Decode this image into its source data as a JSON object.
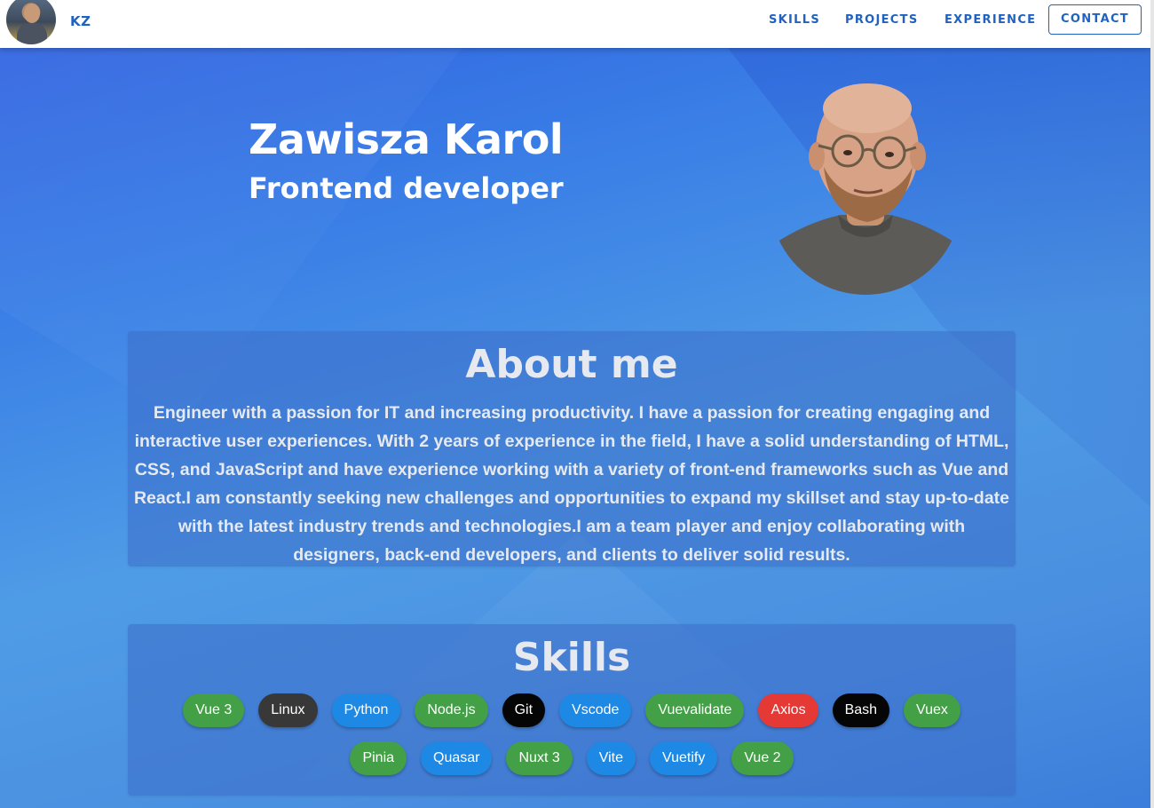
{
  "header": {
    "logo_text": "KZ",
    "nav": {
      "skills": "SKILLS",
      "projects": "PROJECTS",
      "experience": "EXPERIENCE",
      "contact": "CONTACT"
    }
  },
  "hero": {
    "name": "Zawisza Karol",
    "role": "Frontend developer"
  },
  "about": {
    "title": "About me",
    "text": "Engineer with a passion for IT and increasing productivity. I have a passion for creating engaging and interactive user experiences. With 2 years of experience in the field, I have a solid understanding of HTML, CSS, and JavaScript and have experience working with a variety of front-end frameworks such as Vue and React.I am constantly seeking new challenges and opportunities to expand my skillset and stay up-to-date with the latest industry trends and technologies.I am a team player and enjoy collaborating with designers, back-end developers, and clients to deliver solid results."
  },
  "skills": {
    "title": "Skills",
    "rows": [
      [
        {
          "label": "Vue 3",
          "color": "#43a047"
        },
        {
          "label": "Linux",
          "color": "#383838"
        },
        {
          "label": "Python",
          "color": "#1e88e5"
        },
        {
          "label": "Node.js",
          "color": "#43a047"
        },
        {
          "label": "Git",
          "color": "#050505"
        },
        {
          "label": "Vscode",
          "color": "#1e88e5"
        },
        {
          "label": "Vuevalidate",
          "color": "#43a047"
        },
        {
          "label": "Axios",
          "color": "#e53935"
        },
        {
          "label": "Bash",
          "color": "#050505"
        },
        {
          "label": "Vuex",
          "color": "#43a047"
        }
      ],
      [
        {
          "label": "Pinia",
          "color": "#43a047"
        },
        {
          "label": "Quasar",
          "color": "#1e88e5"
        },
        {
          "label": "Nuxt 3",
          "color": "#43a047"
        },
        {
          "label": "Vite",
          "color": "#1e88e5"
        },
        {
          "label": "Vuetify",
          "color": "#1e88e5"
        },
        {
          "label": "Vue 2",
          "color": "#43a047"
        }
      ]
    ]
  },
  "colors": {
    "accent": "#1f62bf",
    "background_top": "#2f5fe0",
    "background_mid": "#4f9ce6",
    "card_text": "#e6e9ef"
  },
  "icons": {
    "avatar": "user-avatar-photo",
    "portrait": "profile-portrait-photo"
  }
}
